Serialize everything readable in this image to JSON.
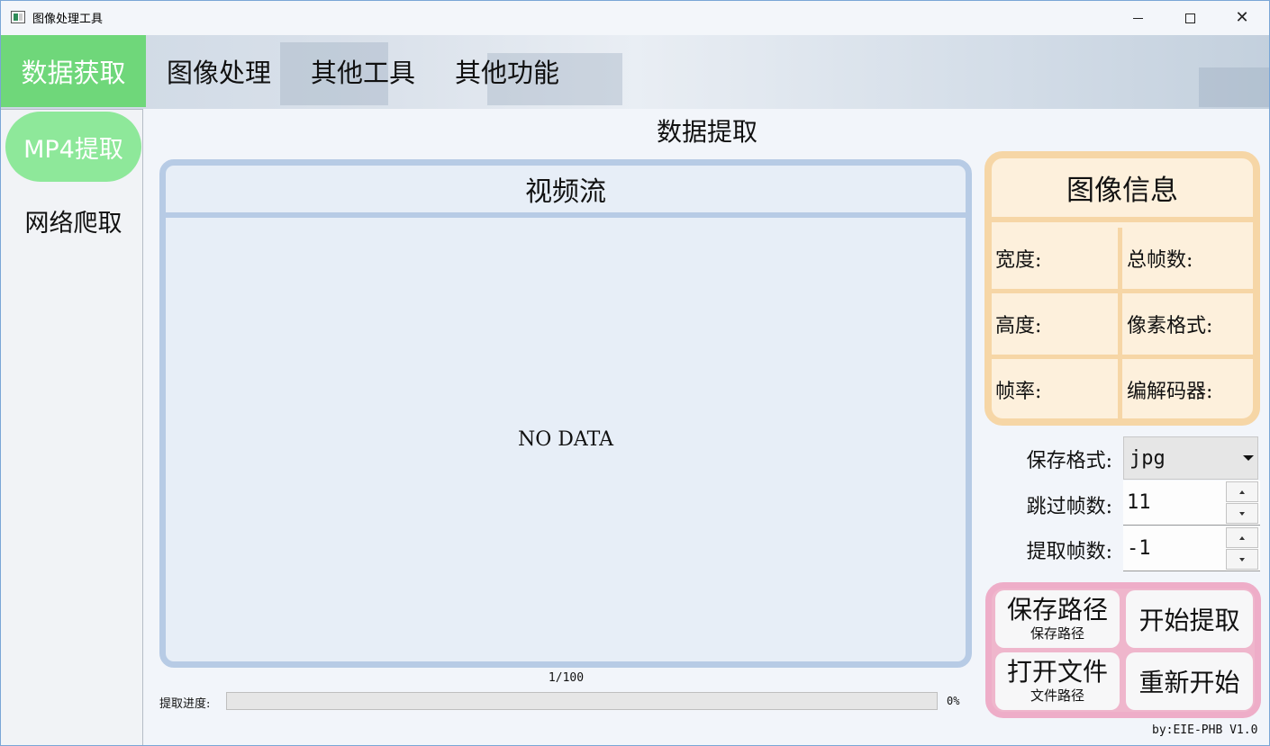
{
  "window": {
    "title": "图像处理工具",
    "minimize_icon": "minimize-icon",
    "maximize_icon": "maximize-icon",
    "close_icon": "close-icon",
    "close_glyph": "✕"
  },
  "top_tabs": [
    {
      "label": "数据获取",
      "active": true
    },
    {
      "label": "图像处理",
      "active": false
    },
    {
      "label": "其他工具",
      "active": false
    },
    {
      "label": "其他功能",
      "active": false
    }
  ],
  "sidebar": {
    "items": [
      {
        "label": "MP4提取",
        "active": true
      },
      {
        "label": "网络爬取",
        "active": false
      }
    ]
  },
  "main": {
    "title": "数据提取",
    "video": {
      "header": "视频流",
      "placeholder": "NO DATA"
    },
    "progress": {
      "count": "1/100",
      "label": "提取进度:",
      "percent_text": "0%",
      "value": 0
    }
  },
  "info_panel": {
    "title": "图像信息",
    "fields": {
      "width": "宽度:",
      "total_frames": "总帧数:",
      "height": "高度:",
      "pixel_format": "像素格式:",
      "frame_rate": "帧率:",
      "codec": "编解码器:"
    }
  },
  "settings": {
    "save_format": {
      "label": "保存格式:",
      "value": "jpg"
    },
    "skip_frames": {
      "label": "跳过帧数:",
      "value": "11"
    },
    "extract_frames": {
      "label": "提取帧数:",
      "value": "-1"
    }
  },
  "actions": {
    "save_path": {
      "label": "保存路径",
      "sub": "保存路径"
    },
    "start": {
      "label": "开始提取"
    },
    "open_file": {
      "label": "打开文件",
      "sub": "文件路径"
    },
    "restart": {
      "label": "重新开始"
    }
  },
  "footer": "by:EIE-PHB V1.0",
  "colors": {
    "tab_active": "#6fd77a",
    "sidebar_active": "#8ee89a",
    "video_border": "#b7cbe5",
    "info_border": "#f6d6a6",
    "action_border": "#eeadc8"
  }
}
